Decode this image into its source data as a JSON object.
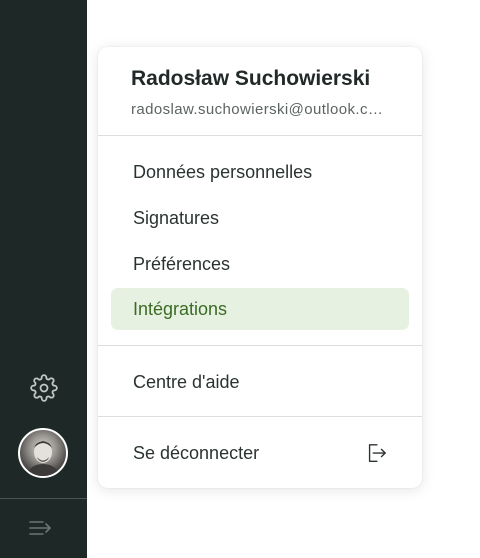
{
  "sidebar": {
    "settings_icon": "gear-icon",
    "avatar_icon": "user-avatar",
    "expand_icon": "sidebar-expand-icon"
  },
  "user": {
    "name": "Radosław Suchowierski",
    "email": "radoslaw.suchowierski@outlook.com"
  },
  "menu": {
    "items": [
      {
        "label": "Données personnelles"
      },
      {
        "label": "Signatures"
      },
      {
        "label": "Préférences"
      },
      {
        "label": "Intégrations",
        "active": true
      }
    ],
    "help_label": "Centre d'aide",
    "logout_label": "Se déconnecter",
    "logout_icon": "logout-icon"
  },
  "colors": {
    "sidebar_bg": "#1e2927",
    "active_bg": "#e6f1e1",
    "active_text": "#3b6b24"
  }
}
